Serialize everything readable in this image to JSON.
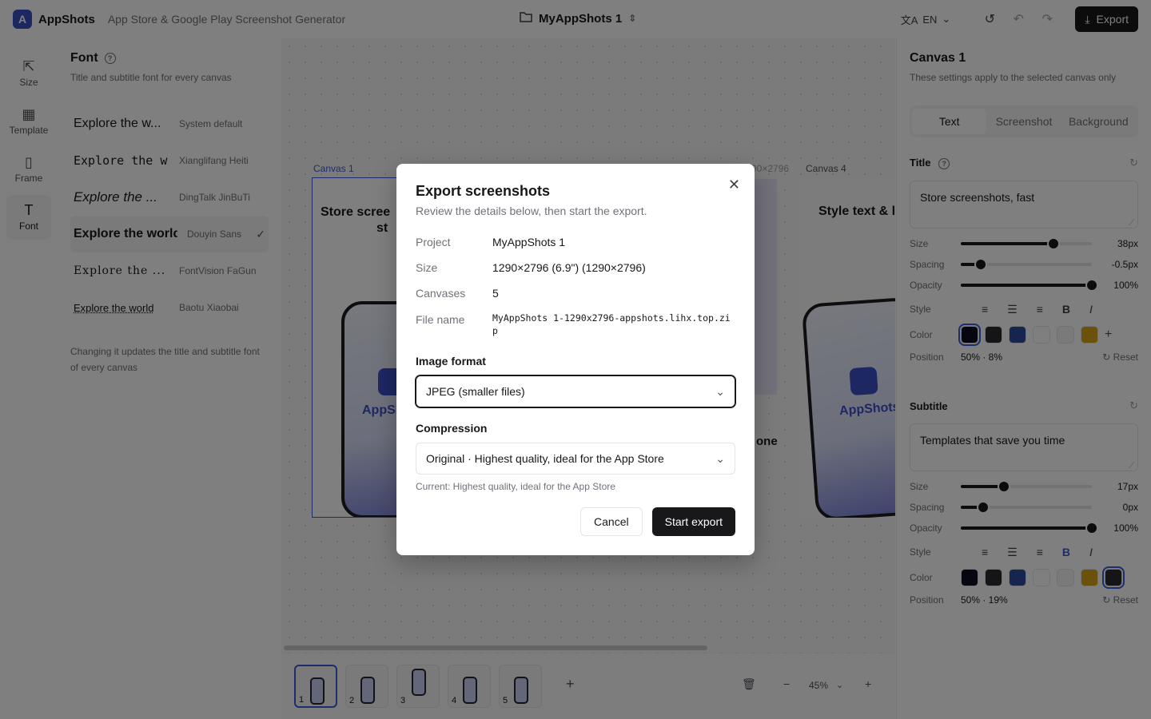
{
  "app": {
    "name": "AppShots",
    "tagline": "App Store & Google Play Screenshot Generator",
    "logo_letter": "A"
  },
  "header": {
    "project": "MyAppShots 1",
    "language": "EN",
    "export_label": "Export"
  },
  "rail": [
    {
      "label": "Size",
      "icon": "size-icon",
      "glyph": "⇱"
    },
    {
      "label": "Template",
      "icon": "template-icon",
      "glyph": "▦"
    },
    {
      "label": "Frame",
      "icon": "frame-icon",
      "glyph": "▯"
    },
    {
      "label": "Font",
      "icon": "font-icon",
      "glyph": "T"
    }
  ],
  "font_panel": {
    "title": "Font",
    "subtitle": "Title and subtitle font for every canvas",
    "fonts": [
      {
        "sample": "Explore the w...",
        "name": "System default"
      },
      {
        "sample": "Explore the w...",
        "name": "Xianglifang Heiti"
      },
      {
        "sample": "Explore the ...",
        "name": "DingTalk JinBuTi"
      },
      {
        "sample": "Explore the world",
        "name": "Douyin Sans"
      },
      {
        "sample": "Explore the ...",
        "name": "FontVision FaGun"
      },
      {
        "sample": "Explore the world",
        "name": "Baotu Xiaobai"
      }
    ],
    "note": "Changing it updates the title and subtitle font of every canvas"
  },
  "canvas": {
    "labels": [
      "Canvas 1",
      "Canvas 4"
    ],
    "partial_label": "90×2796",
    "titles": [
      "Store scree",
      "st",
      "Style text & l",
      "one"
    ],
    "brand_text": "AppSh",
    "brand_text_2": "AppShots"
  },
  "bottom": {
    "thumbs": [
      "1",
      "2",
      "3",
      "4",
      "5"
    ],
    "zoom": "45%"
  },
  "right_panel": {
    "title": "Canvas 1",
    "subtitle": "These settings apply to the selected canvas only",
    "tabs": [
      "Text",
      "Screenshot",
      "Background"
    ],
    "title_section": {
      "label": "Title",
      "text": "Store screenshots, fast",
      "size": "38px",
      "size_level": 0.71,
      "spacing": "-0.5px",
      "spacing_level": 0.15,
      "opacity": "100%",
      "opacity_level": 1.0,
      "position": "50% · 8%"
    },
    "subtitle_section": {
      "label": "Subtitle",
      "text": "Templates that save you time",
      "size": "17px",
      "size_level": 0.33,
      "spacing": "0px",
      "spacing_level": 0.17,
      "opacity": "100%",
      "opacity_level": 1.0,
      "position": "50% · 19%"
    },
    "labels": {
      "size": "Size",
      "spacing": "Spacing",
      "opacity": "Opacity",
      "style": "Style",
      "color": "Color",
      "position": "Position",
      "reset": "Reset"
    },
    "colors": [
      "#0b0c1f",
      "#2a2a2e",
      "#2d4aa0",
      "#ffffff",
      "#f4f4f5",
      "#d4a514"
    ]
  },
  "modal": {
    "title": "Export screenshots",
    "description": "Review the details below, then start the export.",
    "rows": [
      {
        "label": "Project",
        "value": "MyAppShots 1"
      },
      {
        "label": "Size",
        "value": "1290×2796 (6.9\") (1290×2796)"
      },
      {
        "label": "Canvases",
        "value": "5"
      },
      {
        "label": "File name",
        "value": "MyAppShots 1-1290x2796-appshots.lihx.top.zip"
      }
    ],
    "image_format_label": "Image format",
    "image_format_value": "JPEG (smaller files)",
    "compression_label": "Compression",
    "compression_value": "Original · Highest quality, ideal for the App Store",
    "compression_hint": "Current: Highest quality, ideal for the App Store",
    "cancel_label": "Cancel",
    "start_label": "Start export"
  }
}
